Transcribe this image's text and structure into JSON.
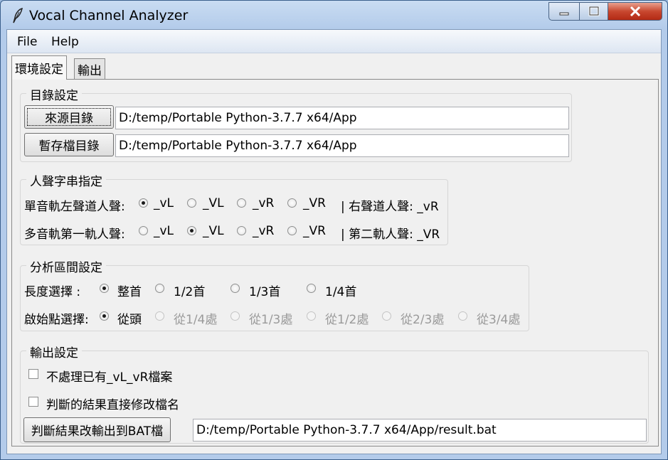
{
  "window": {
    "title": "Vocal Channel Analyzer"
  },
  "menu": {
    "file": "File",
    "help": "Help"
  },
  "tabs": [
    {
      "label": "環境設定",
      "active": true
    },
    {
      "label": "輸出",
      "active": false
    }
  ],
  "directory_settings": {
    "title": "目錄設定",
    "source": {
      "button": "來源目錄",
      "value": "D:/temp/Portable Python-3.7.7 x64/App"
    },
    "temp": {
      "button": "暫存檔目錄",
      "value": "D:/temp/Portable Python-3.7.7 x64/App"
    }
  },
  "vocal_string": {
    "title": "人聲字串指定",
    "rows": [
      {
        "label": "單音軌左聲道人聲:",
        "options": [
          "_vL",
          "_VL",
          "_vR",
          "_VR"
        ],
        "selected": 0,
        "tail": "| 右聲道人聲: _vR"
      },
      {
        "label": "多音軌第一軌人聲:",
        "options": [
          "_vL",
          "_VL",
          "_vR",
          "_VR"
        ],
        "selected": 1,
        "tail": "| 第二軌人聲: _VR"
      }
    ]
  },
  "analysis_range": {
    "title": "分析區間設定",
    "length": {
      "label": "長度選擇 :",
      "options": [
        "整首",
        "1/2首",
        "1/3首",
        "1/4首"
      ],
      "selected": 0
    },
    "start": {
      "label": "啟始點選擇:",
      "options": [
        "從頭",
        "從1/4處",
        "從1/3處",
        "從1/2處",
        "從2/3處",
        "從3/4處"
      ],
      "selected": 0,
      "enabled_count": 1
    }
  },
  "output_settings": {
    "title": "輸出設定",
    "skip_existing": {
      "label": "不處理已有_vL_vR檔案",
      "checked": false
    },
    "rename": {
      "label": "判斷的結果直接修改檔名",
      "checked": false
    },
    "bat": {
      "button": "判斷結果改輸出到BAT檔",
      "value": "D:/temp/Portable Python-3.7.7 x64/App/result.bat"
    }
  }
}
